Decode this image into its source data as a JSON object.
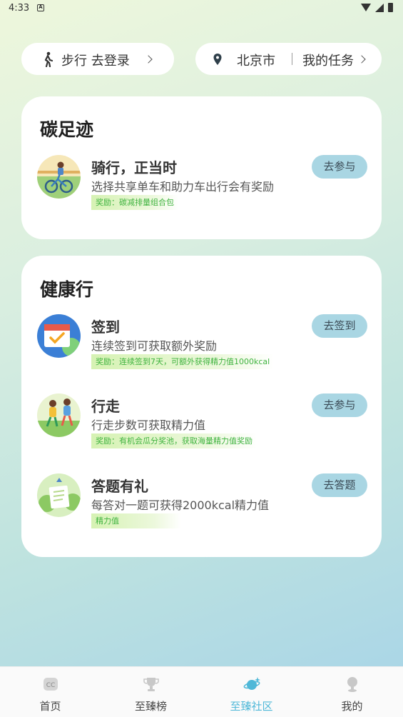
{
  "status_bar": {
    "time": "4:33",
    "notif_icon": "A"
  },
  "top": {
    "login_label": "步行 去登录",
    "city": "北京市",
    "my_tasks": "我的任务"
  },
  "carbon": {
    "title": "碳足迹",
    "tasks": [
      {
        "name": "骑行，正当时",
        "desc": "选择共享单车和助力车出行会有奖励",
        "reward": "奖励：碳减排量组合包",
        "button": "去参与",
        "icon": "cycling-avatar"
      }
    ]
  },
  "health": {
    "title": "健康行",
    "tasks": [
      {
        "name": "签到",
        "desc": "连续签到可获取额外奖励",
        "reward": "奖励：连续签到7天，可额外获得精力值1000kcal",
        "button": "去签到",
        "icon": "calendar-check-avatar"
      },
      {
        "name": "行走",
        "desc": "行走步数可获取精力值",
        "reward": "奖励：有机会瓜分奖池，获取海量精力值奖励",
        "button": "去参与",
        "icon": "walking-avatar"
      },
      {
        "name": "答题有礼",
        "desc": "每答对一题可获得2000kcal精力值",
        "reward": "精力值",
        "button": "去答题",
        "icon": "quiz-avatar"
      }
    ]
  },
  "nav": [
    {
      "label": "首页",
      "icon": "home-icon",
      "active": false
    },
    {
      "label": "至臻榜",
      "icon": "trophy-icon",
      "active": false
    },
    {
      "label": "至臻社区",
      "icon": "planet-icon",
      "active": true
    },
    {
      "label": "我的",
      "icon": "profile-icon",
      "active": false
    }
  ],
  "colors": {
    "accent": "#4fb8d8",
    "button_bg": "#a9d6e3",
    "reward_green": "#3fb33f"
  }
}
